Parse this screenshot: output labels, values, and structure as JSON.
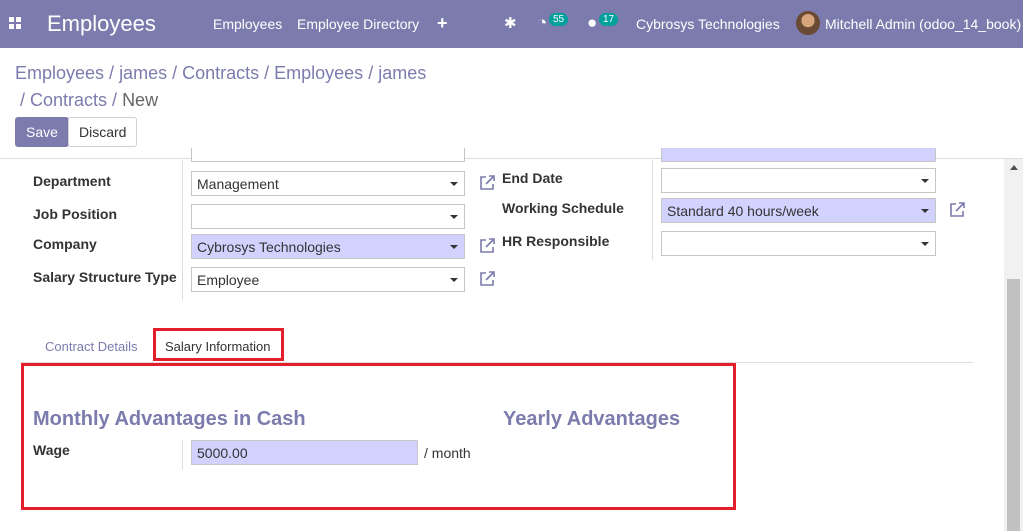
{
  "topbar": {
    "app_title": "Employees",
    "menu": [
      "Employees",
      "Employee Directory"
    ],
    "activity_count": "55",
    "message_count": "17",
    "company": "Cybrosys Technologies",
    "user": "Mitchell Admin (odoo_14_book)"
  },
  "breadcrumb": {
    "items": [
      "Employees",
      "james",
      "Contracts",
      "Employees",
      "james",
      "Contracts"
    ],
    "current": "New"
  },
  "buttons": {
    "save": "Save",
    "discard": "Discard"
  },
  "form": {
    "left": {
      "department": {
        "label": "Department",
        "value": "Management"
      },
      "job_position": {
        "label": "Job Position",
        "value": ""
      },
      "company": {
        "label": "Company",
        "value": "Cybrosys Technologies"
      },
      "salary_structure_type": {
        "label": "Salary Structure Type",
        "value": "Employee"
      }
    },
    "right": {
      "end_date": {
        "label": "End Date",
        "value": ""
      },
      "working_schedule": {
        "label": "Working Schedule",
        "value": "Standard 40 hours/week"
      },
      "hr_responsible": {
        "label": "HR Responsible",
        "value": ""
      }
    }
  },
  "tabs": [
    "Contract Details",
    "Salary Information"
  ],
  "salary": {
    "monthly_title": "Monthly Advantages in Cash",
    "yearly_title": "Yearly Advantages",
    "wage_label": "Wage",
    "wage_value": "5000.00",
    "wage_unit": "/ month"
  },
  "icons": {
    "apps": "apps-grid-icon",
    "plus": "plus-icon",
    "bug": "bug-icon",
    "activity": "activity-clock-icon",
    "messages": "chat-bubble-icon",
    "external": "external-link-icon"
  },
  "colors": {
    "brand": "#7c7bad",
    "badge": "#00a09d",
    "required": "#d2d2ff",
    "highlight": "#e21f2a"
  }
}
